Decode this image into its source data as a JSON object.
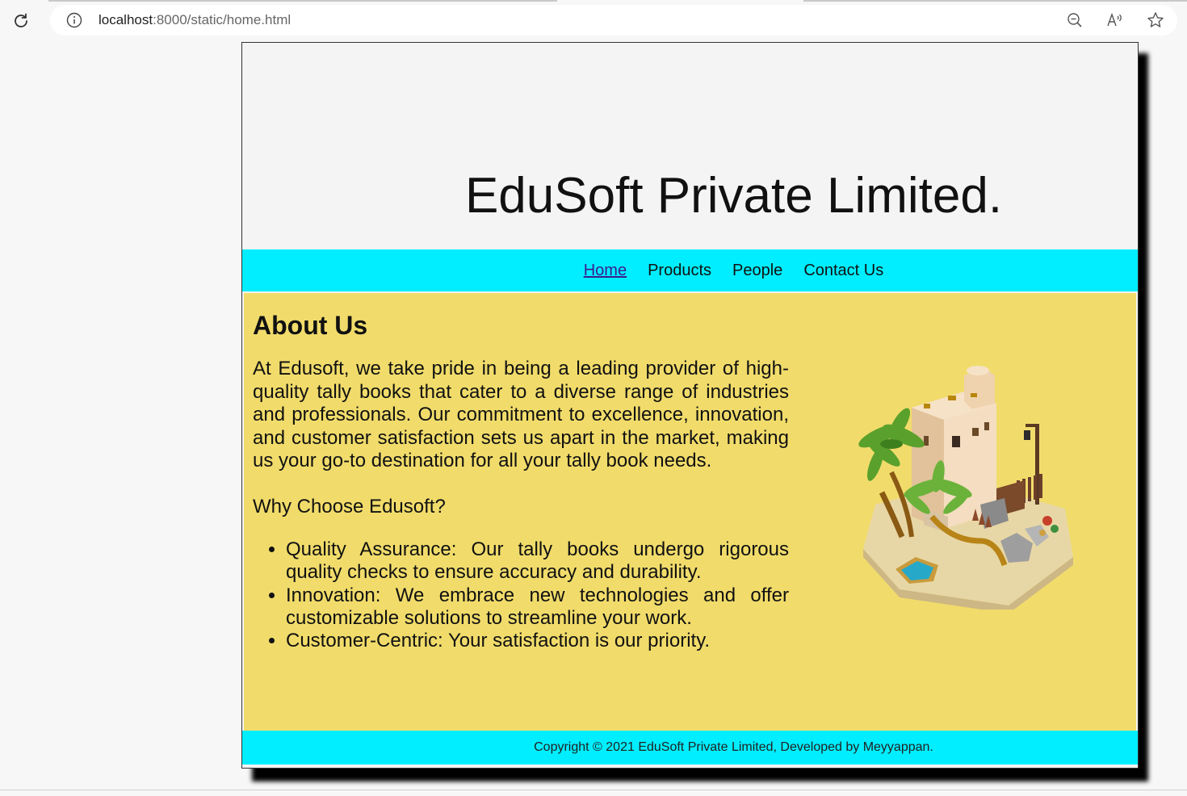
{
  "browser": {
    "url_host": "localhost",
    "url_rest": ":8000/static/home.html",
    "icons": [
      "reload-icon",
      "info-icon",
      "zoom-out-icon",
      "read-aloud-icon",
      "favorite-star-icon"
    ]
  },
  "site": {
    "title": "EduSoft Private Limited."
  },
  "nav": {
    "items": [
      {
        "label": "Home",
        "current": true
      },
      {
        "label": "Products"
      },
      {
        "label": "People"
      },
      {
        "label": "Contact Us"
      }
    ]
  },
  "main": {
    "heading": "About Us",
    "intro": "At Edusoft, we take pride in being a leading provider of high-quality tally books that cater to a diverse range of industries and professionals. Our commitment to excellence, innovation, and customer satisfaction sets us apart in the market, making us your go-to destination for all your tally book needs.",
    "why": "Why Choose Edusoft?",
    "features": [
      "Quality Assurance: Our tally books undergo rigorous quality checks to ensure accuracy and durability.",
      "Innovation: We embrace new technologies and offer customizable solutions to streamline your work.",
      "Customer-Centric: Your satisfaction is our priority."
    ]
  },
  "footer": {
    "text": "Copyright © 2021 EduSoft Private Limited, Developed by Meyyappan."
  },
  "colors": {
    "nav_bg": "#00eeff",
    "main_bg": "#f1dc6b",
    "header_bg": "#f4f4f4"
  }
}
